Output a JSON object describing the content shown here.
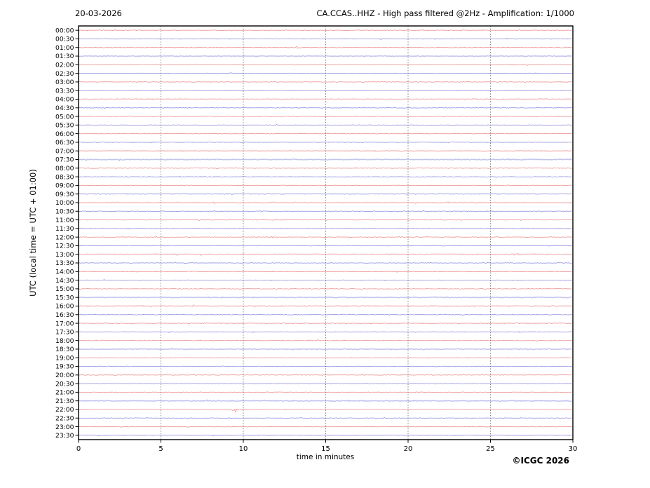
{
  "header": {
    "date": "20-03-2026",
    "title": "CA.CCAS..HHZ - High pass filtered @2Hz - Amplification: 1/1000"
  },
  "footer": {
    "xlabel": "time in minutes",
    "copyright": "©ICGC 2026"
  },
  "y_axis": {
    "label": "UTC (local time = UTC + 01:00)"
  },
  "chart_data": {
    "type": "line",
    "subtype": "helicorder-seismogram",
    "title": "CA.CCAS..HHZ - High pass filtered @2Hz - Amplification: 1/1000",
    "date": "20-03-2026",
    "xlabel": "time in minutes",
    "ylabel": "UTC (local time = UTC + 01:00)",
    "x_range": [
      0,
      30
    ],
    "x_ticks": [
      0,
      5,
      10,
      15,
      20,
      25,
      30
    ],
    "x_gridlines": [
      5,
      10,
      15,
      20,
      25
    ],
    "grid": "vertical-dashed",
    "minutes_per_row": 30,
    "colors": {
      "red_trace": "#dd4444",
      "blue_trace": "#4444cc",
      "grid": "#777777",
      "axis": "#000000",
      "background": "#ffffff"
    },
    "rows": [
      {
        "label": "00:00",
        "color": "red",
        "shade": "normal"
      },
      {
        "label": "00:30",
        "color": "blue",
        "shade": "normal"
      },
      {
        "label": "01:00",
        "color": "red",
        "shade": "normal"
      },
      {
        "label": "01:30",
        "color": "blue",
        "shade": "light"
      },
      {
        "label": "02:00",
        "color": "red",
        "shade": "normal"
      },
      {
        "label": "02:30",
        "color": "blue",
        "shade": "normal"
      },
      {
        "label": "03:00",
        "color": "red",
        "shade": "normal"
      },
      {
        "label": "03:30",
        "color": "blue",
        "shade": "normal"
      },
      {
        "label": "04:00",
        "color": "red",
        "shade": "light"
      },
      {
        "label": "04:30",
        "color": "blue",
        "shade": "normal"
      },
      {
        "label": "05:00",
        "color": "red",
        "shade": "normal"
      },
      {
        "label": "05:30",
        "color": "blue",
        "shade": "normal"
      },
      {
        "label": "06:00",
        "color": "red",
        "shade": "normal"
      },
      {
        "label": "06:30",
        "color": "blue",
        "shade": "normal"
      },
      {
        "label": "07:00",
        "color": "red",
        "shade": "light"
      },
      {
        "label": "07:30",
        "color": "blue",
        "shade": "light"
      },
      {
        "label": "08:00",
        "color": "red",
        "shade": "normal"
      },
      {
        "label": "08:30",
        "color": "blue",
        "shade": "normal"
      },
      {
        "label": "09:00",
        "color": "red",
        "shade": "normal"
      },
      {
        "label": "09:30",
        "color": "blue",
        "shade": "normal"
      },
      {
        "label": "10:00",
        "color": "red",
        "shade": "light"
      },
      {
        "label": "10:30",
        "color": "blue",
        "shade": "normal"
      },
      {
        "label": "11:00",
        "color": "red",
        "shade": "normal"
      },
      {
        "label": "11:30",
        "color": "blue",
        "shade": "normal"
      },
      {
        "label": "12:00",
        "color": "red",
        "shade": "normal"
      },
      {
        "label": "12:30",
        "color": "blue",
        "shade": "normal"
      },
      {
        "label": "13:00",
        "color": "red",
        "shade": "light"
      },
      {
        "label": "13:30",
        "color": "blue",
        "shade": "normal"
      },
      {
        "label": "14:00",
        "color": "red",
        "shade": "normal"
      },
      {
        "label": "14:30",
        "color": "blue",
        "shade": "normal"
      },
      {
        "label": "15:00",
        "color": "red",
        "shade": "normal"
      },
      {
        "label": "15:30",
        "color": "blue",
        "shade": "light"
      },
      {
        "label": "16:00",
        "color": "red",
        "shade": "light"
      },
      {
        "label": "16:30",
        "color": "blue",
        "shade": "normal"
      },
      {
        "label": "17:00",
        "color": "red",
        "shade": "normal"
      },
      {
        "label": "17:30",
        "color": "blue",
        "shade": "normal"
      },
      {
        "label": "18:00",
        "color": "red",
        "shade": "normal"
      },
      {
        "label": "18:30",
        "color": "blue",
        "shade": "light"
      },
      {
        "label": "19:00",
        "color": "red",
        "shade": "normal"
      },
      {
        "label": "19:30",
        "color": "blue",
        "shade": "normal"
      },
      {
        "label": "20:00",
        "color": "red",
        "shade": "normal"
      },
      {
        "label": "20:30",
        "color": "blue",
        "shade": "normal"
      },
      {
        "label": "21:00",
        "color": "red",
        "shade": "normal"
      },
      {
        "label": "21:30",
        "color": "blue",
        "shade": "light"
      },
      {
        "label": "22:00",
        "color": "red",
        "shade": "normal"
      },
      {
        "label": "22:30",
        "color": "blue",
        "shade": "normal"
      },
      {
        "label": "23:00",
        "color": "red",
        "shade": "normal"
      },
      {
        "label": "23:30",
        "color": "blue",
        "shade": "normal"
      }
    ],
    "events": [
      {
        "row": "01:00",
        "minute": 13.3,
        "amplitude": 1.1,
        "half_width_min": 0.6
      },
      {
        "row": "03:30",
        "minute": 23.4,
        "amplitude": 1.0,
        "half_width_min": 0.5
      },
      {
        "row": "11:30",
        "minute": 3.1,
        "amplitude": 1.0,
        "half_width_min": 0.5
      },
      {
        "row": "12:00",
        "minute": 11.7,
        "amplitude": 1.3,
        "half_width_min": 0.4
      },
      {
        "row": "13:00",
        "minute": 26.5,
        "amplitude": 1.1,
        "half_width_min": 1.0
      },
      {
        "row": "22:00",
        "minute": 9.5,
        "amplitude": 5.5,
        "half_width_min": 0.3
      }
    ]
  }
}
